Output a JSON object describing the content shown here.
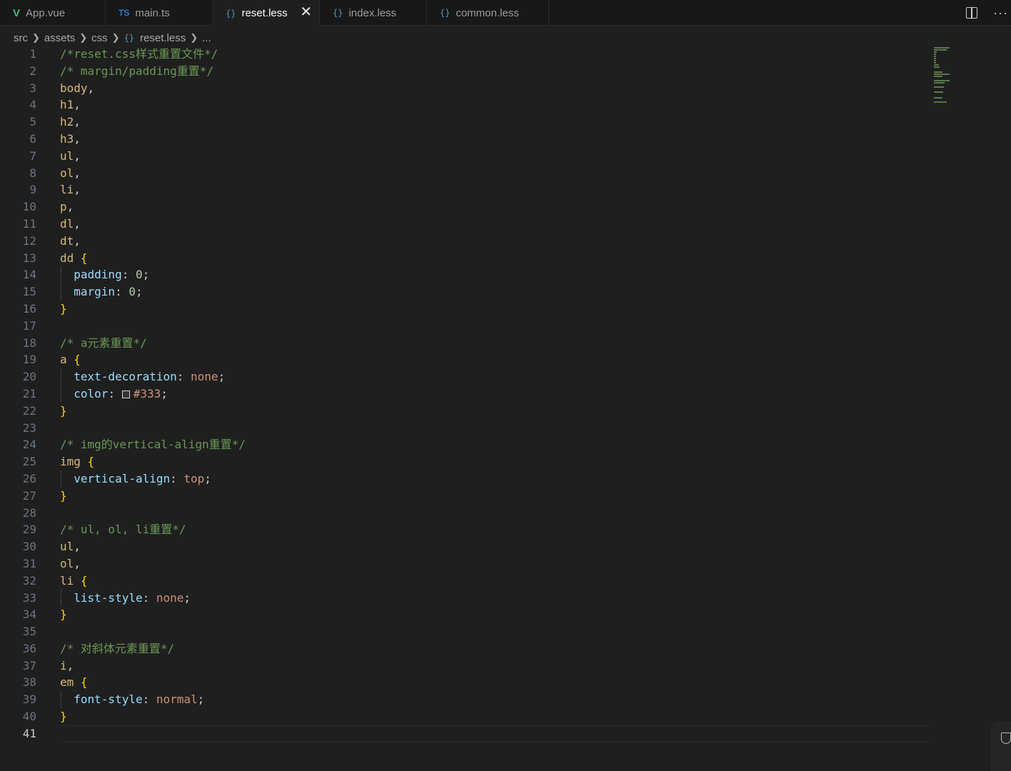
{
  "tabs": [
    {
      "icon": "V",
      "label": "App.vue"
    },
    {
      "icon": "TS",
      "label": "main.ts"
    },
    {
      "icon": "{}",
      "label": "reset.less",
      "active": true
    },
    {
      "icon": "{}",
      "label": "index.less"
    },
    {
      "icon": "{}",
      "label": "common.less"
    }
  ],
  "tab_close": "✕",
  "more": "···",
  "breadcrumb": [
    "src",
    "assets",
    "css",
    "reset.less",
    "..."
  ],
  "breadcrumb_icon": "{}",
  "color_swatch": "#333333",
  "lines": [
    [
      [
        "com",
        "/*reset.css样式重置文件*/"
      ]
    ],
    [
      [
        "com",
        "/* margin/padding重置*/"
      ]
    ],
    [
      [
        "sel",
        "body"
      ],
      [
        "punc",
        ","
      ]
    ],
    [
      [
        "sel",
        "h1"
      ],
      [
        "punc",
        ","
      ]
    ],
    [
      [
        "sel",
        "h2"
      ],
      [
        "punc",
        ","
      ]
    ],
    [
      [
        "sel",
        "h3"
      ],
      [
        "punc",
        ","
      ]
    ],
    [
      [
        "sel",
        "ul"
      ],
      [
        "punc",
        ","
      ]
    ],
    [
      [
        "sel",
        "ol"
      ],
      [
        "punc",
        ","
      ]
    ],
    [
      [
        "sel",
        "li"
      ],
      [
        "punc",
        ","
      ]
    ],
    [
      [
        "sel",
        "p"
      ],
      [
        "punc",
        ","
      ]
    ],
    [
      [
        "sel",
        "dl"
      ],
      [
        "punc",
        ","
      ]
    ],
    [
      [
        "sel",
        "dt"
      ],
      [
        "punc",
        ","
      ]
    ],
    [
      [
        "sel",
        "dd"
      ],
      [
        "punc",
        " "
      ],
      [
        "brace",
        "{"
      ]
    ],
    [
      [
        "punc",
        "  "
      ],
      [
        "prop",
        "padding"
      ],
      [
        "punc",
        ": "
      ],
      [
        "num",
        "0"
      ],
      [
        "punc",
        ";"
      ]
    ],
    [
      [
        "punc",
        "  "
      ],
      [
        "prop",
        "margin"
      ],
      [
        "punc",
        ": "
      ],
      [
        "num",
        "0"
      ],
      [
        "punc",
        ";"
      ]
    ],
    [
      [
        "brace",
        "}"
      ]
    ],
    [],
    [
      [
        "com",
        "/* a元素重置*/"
      ]
    ],
    [
      [
        "sel",
        "a"
      ],
      [
        "punc",
        " "
      ],
      [
        "brace",
        "{"
      ]
    ],
    [
      [
        "punc",
        "  "
      ],
      [
        "prop",
        "text-decoration"
      ],
      [
        "punc",
        ": "
      ],
      [
        "val",
        "none"
      ],
      [
        "punc",
        ";"
      ]
    ],
    [
      [
        "punc",
        "  "
      ],
      [
        "prop",
        "color"
      ],
      [
        "punc",
        ": "
      ],
      [
        "swatch",
        ""
      ],
      [
        "val",
        "#333"
      ],
      [
        "punc",
        ";"
      ]
    ],
    [
      [
        "brace",
        "}"
      ]
    ],
    [],
    [
      [
        "com",
        "/* img的vertical-align重置*/"
      ]
    ],
    [
      [
        "sel",
        "img"
      ],
      [
        "punc",
        " "
      ],
      [
        "brace",
        "{"
      ]
    ],
    [
      [
        "punc",
        "  "
      ],
      [
        "prop",
        "vertical-align"
      ],
      [
        "punc",
        ": "
      ],
      [
        "val",
        "top"
      ],
      [
        "punc",
        ";"
      ]
    ],
    [
      [
        "brace",
        "}"
      ]
    ],
    [],
    [
      [
        "com",
        "/* ul, ol, li重置*/"
      ]
    ],
    [
      [
        "sel",
        "ul"
      ],
      [
        "punc",
        ","
      ]
    ],
    [
      [
        "sel",
        "ol"
      ],
      [
        "punc",
        ","
      ]
    ],
    [
      [
        "sel",
        "li"
      ],
      [
        "punc",
        " "
      ],
      [
        "brace",
        "{"
      ]
    ],
    [
      [
        "punc",
        "  "
      ],
      [
        "prop",
        "list-style"
      ],
      [
        "punc",
        ": "
      ],
      [
        "val",
        "none"
      ],
      [
        "punc",
        ";"
      ]
    ],
    [
      [
        "brace",
        "}"
      ]
    ],
    [],
    [
      [
        "com",
        "/* 对斜体元素重置*/"
      ]
    ],
    [
      [
        "sel",
        "i"
      ],
      [
        "punc",
        ","
      ]
    ],
    [
      [
        "sel",
        "em"
      ],
      [
        "punc",
        " "
      ],
      [
        "brace",
        "{"
      ]
    ],
    [
      [
        "punc",
        "  "
      ],
      [
        "prop",
        "font-style"
      ],
      [
        "punc",
        ": "
      ],
      [
        "val",
        "normal"
      ],
      [
        "punc",
        ";"
      ]
    ],
    [
      [
        "brace",
        "}"
      ]
    ],
    []
  ],
  "current_line": 41
}
